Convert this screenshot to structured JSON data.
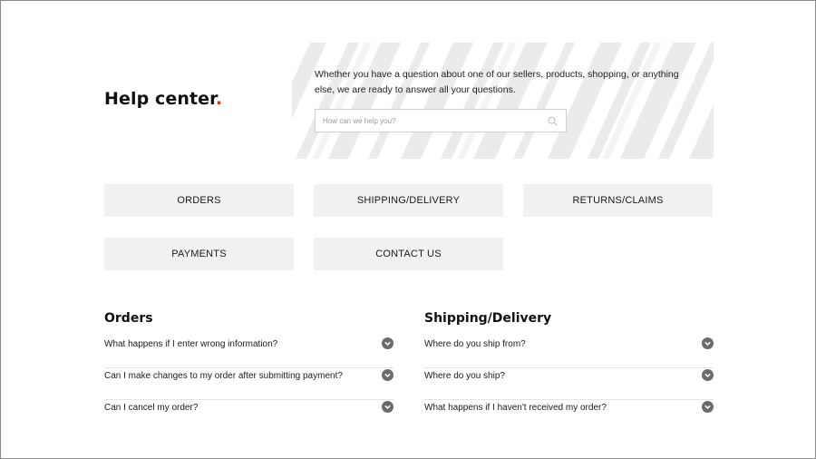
{
  "header": {
    "title": "Help center",
    "title_dot": "."
  },
  "search": {
    "intro": "Whether you have a question about one of our sellers, products, shopping, or anything else, we are ready to answer all your questions.",
    "placeholder": "How can we help you?",
    "icon": "search-icon"
  },
  "categories": [
    {
      "label": "ORDERS"
    },
    {
      "label": "SHIPPING/DELIVERY"
    },
    {
      "label": "RETURNS/CLAIMS"
    },
    {
      "label": "PAYMENTS"
    },
    {
      "label": "CONTACT US"
    }
  ],
  "faq": {
    "orders": {
      "heading": "Orders",
      "items": [
        {
          "q": "What happens if I enter wrong information?"
        },
        {
          "q": "Can I make changes to my order after submitting payment?"
        },
        {
          "q": "Can I cancel my order?"
        }
      ]
    },
    "shipping": {
      "heading": "Shipping/Delivery",
      "items": [
        {
          "q": "Where do you ship from?"
        },
        {
          "q": "Where do you ship?"
        },
        {
          "q": "What happens if I haven't received my order?"
        }
      ]
    }
  },
  "colors": {
    "accent_dot": "#d63a2a",
    "button_bg": "#f1f1f1",
    "chevron_bg": "#6b6b6b"
  }
}
